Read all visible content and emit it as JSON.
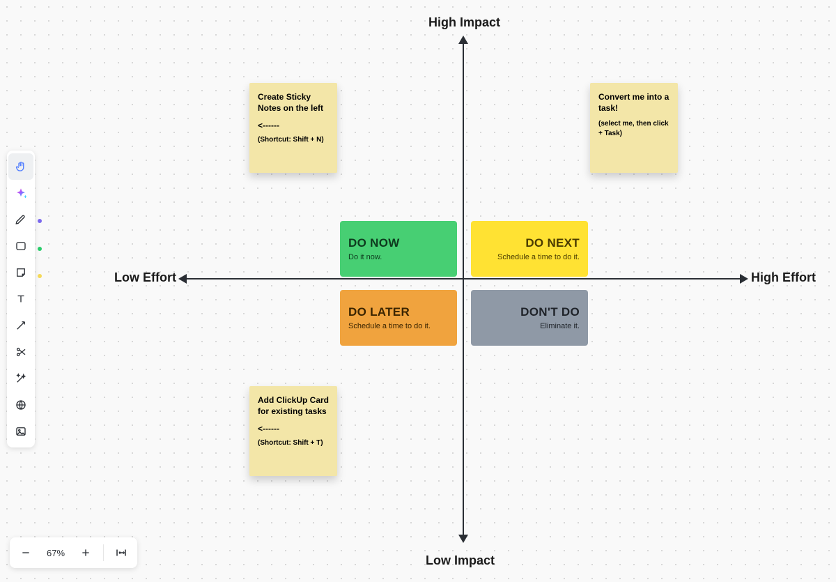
{
  "axes": {
    "top": "High Impact",
    "bottom": "Low Impact",
    "left": "Low Effort",
    "right": "High Effort"
  },
  "quadrants": {
    "do_now": {
      "title": "DO NOW",
      "sub": "Do it now."
    },
    "do_next": {
      "title": "DO NEXT",
      "sub": "Schedule a time to do it."
    },
    "do_later": {
      "title": "DO LATER",
      "sub": "Schedule a time to do it."
    },
    "dont_do": {
      "title": "DON'T DO",
      "sub": "Eliminate it."
    }
  },
  "stickies": {
    "s1": {
      "title": "Create Sticky Notes on the left",
      "arrow": "<------",
      "shortcut": "(Shortcut: Shift + N)"
    },
    "s2": {
      "title": "Convert me into a task!",
      "sub": "(select me, then click + Task)"
    },
    "s3": {
      "title": "Add ClickUp Card for existing tasks",
      "arrow": "<------",
      "shortcut": "(Shortcut: Shift + T)"
    }
  },
  "zoom": {
    "level": "67%"
  },
  "colors": {
    "do_now": "#47cf73",
    "do_next": "#ffe233",
    "do_later": "#f0a33e",
    "dont_do": "#8f99a6",
    "sticky": "#f3e6a8"
  }
}
